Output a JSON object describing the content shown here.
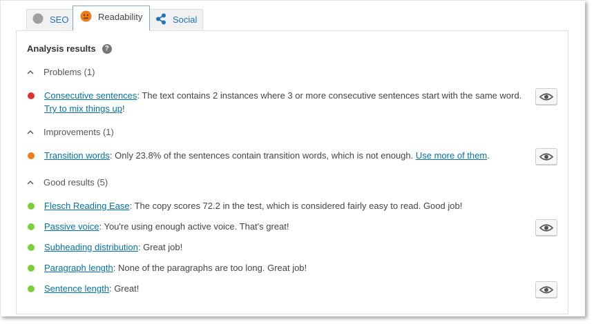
{
  "tabs": [
    {
      "label": "SEO",
      "icon": "seo-score-icon",
      "active": false
    },
    {
      "label": "Readability",
      "icon": "readability-score-icon",
      "active": true
    },
    {
      "label": "Social",
      "icon": "share-icon",
      "active": false
    }
  ],
  "analysis": {
    "title": "Analysis results",
    "help_icon": "help-icon",
    "help_glyph": "?"
  },
  "groups": {
    "problems": {
      "label": "Problems (1)",
      "items": [
        {
          "link": "Consecutive sentences",
          "text": ": The text contains 2 instances where 3 or more consecutive sentences start with the same word. ",
          "link2": "Try to mix things up",
          "tail": "!",
          "color": "#dc3232"
        }
      ]
    },
    "improvements": {
      "label": "Improvements (1)",
      "items": [
        {
          "link": "Transition words",
          "text": ": Only 23.8% of the sentences contain transition words, which is not enough. ",
          "link2": "Use more of them",
          "tail": ".",
          "color": "#ee7c1b"
        }
      ]
    },
    "good": {
      "label": "Good results (5)",
      "items": [
        {
          "link": "Flesch Reading Ease",
          "text": ": The copy scores 72.2 in the test, which is considered fairly easy to read. Good job!",
          "color": "#7ad03a"
        },
        {
          "link": "Passive voice",
          "text": ": You're using enough active voice. That's great!",
          "color": "#7ad03a"
        },
        {
          "link": "Subheading distribution",
          "text": ": Great job!",
          "color": "#7ad03a"
        },
        {
          "link": "Paragraph length",
          "text": ": None of the paragraphs are too long. Great job!",
          "color": "#7ad03a"
        },
        {
          "link": "Sentence length",
          "text": ": Great!",
          "color": "#7ad03a"
        }
      ]
    }
  },
  "colors": {
    "link": "#0073aa",
    "problem": "#dc3232",
    "improvement": "#ee7c1b",
    "good": "#7ad03a",
    "seo_gray": "#999999"
  }
}
